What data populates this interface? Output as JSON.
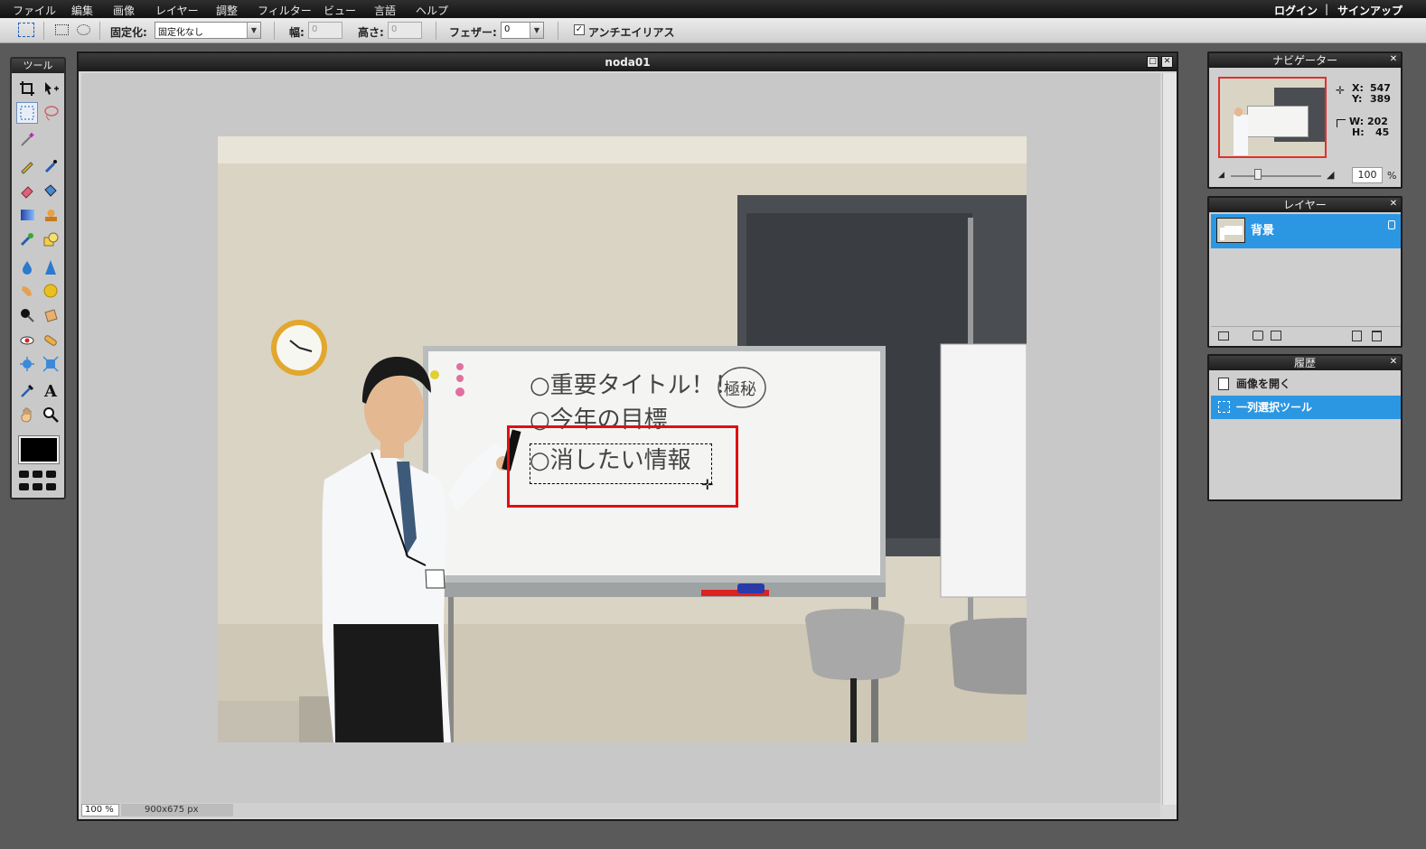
{
  "menubar": {
    "items": [
      "ファイル",
      "編集",
      "画像",
      "レイヤー",
      "調整",
      "フィルター",
      "ビュー",
      "言語",
      "ヘルプ"
    ],
    "login": "ログイン",
    "divider": "|",
    "signup": "サインアップ"
  },
  "options": {
    "fixed_label": "固定化:",
    "fixed_value": "固定化なし",
    "width_label": "幅:",
    "width_value": "0",
    "height_label": "高さ:",
    "height_value": "0",
    "feather_label": "フェザー:",
    "feather_value": "0",
    "antialias_label": "アンチエイリアス",
    "antialias_checked": true
  },
  "tools": {
    "title": "ツール",
    "foreground_color": "#000000"
  },
  "document": {
    "title": "noda01",
    "zoom": "100 %",
    "size": "900x675 px",
    "whiteboard_lines": [
      "○重要タイトル！！",
      "○今年の目標",
      "○消したい情報"
    ],
    "stamp": "極秘"
  },
  "navigator": {
    "title": "ナビゲーター",
    "x_label": "X:",
    "x_value": "547",
    "y_label": "Y:",
    "y_value": "389",
    "w_label": "W:",
    "w_value": "202",
    "h_label": "H:",
    "h_value": "45",
    "zoom_value": "100",
    "zoom_unit": "%"
  },
  "layers": {
    "title": "レイヤー",
    "items": [
      {
        "name": "背景",
        "selected": true,
        "locked": true
      }
    ]
  },
  "history": {
    "title": "履歴",
    "items": [
      {
        "label": "画像を開く",
        "selected": false
      },
      {
        "label": "一列選択ツール",
        "selected": true
      }
    ]
  },
  "colors": {
    "selection": "#2b97e3",
    "highlight_box": "#e01010"
  }
}
